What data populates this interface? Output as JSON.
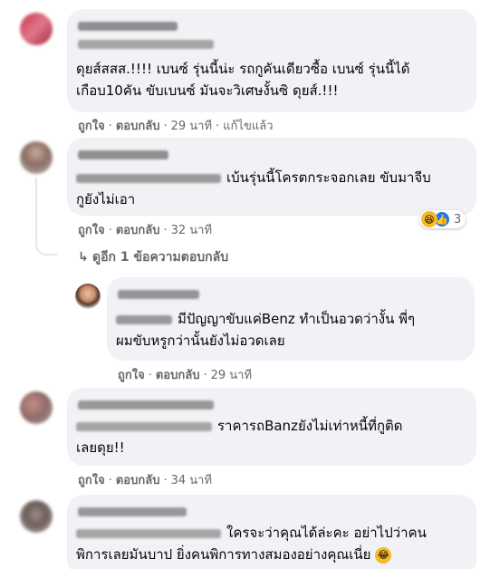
{
  "colors": {
    "bubble": "#f0f2f5",
    "secondary_text": "#65676b",
    "like_blue": "#1877f2",
    "haha_yellow": "#f7b928"
  },
  "comments": [
    {
      "text_lines": [
        "ดุยส์สสส.!!!! เบนซ์ รุ่นนี้น่ะ รถกูคันเดียวซื้อ เบนซ์ รุ่นนี้ได้",
        "เกือบ10คัน ขับเบนซ์ มันจะวิเศษงั้นซิ ดุยส์.!!!"
      ],
      "like_label": "ถูกใจ",
      "reply_label": "ตอบกลับ",
      "time": "29 นาที",
      "edited": "แก้ไขแล้ว"
    },
    {
      "text_lines": [
        "เบ้นรุ่นนี้โครตกระจอกเลย ขับมาจีบ",
        "กูยังไม่เอา"
      ],
      "like_label": "ถูกใจ",
      "reply_label": "ตอบกลับ",
      "time": "32 นาที",
      "reaction_count": "3",
      "reaction_icons": [
        "haha-icon",
        "like-icon"
      ],
      "view_more": "ดูอีก 1 ข้อความตอบกลับ"
    },
    {
      "text_lines": [
        "มีปัญญาขับแค่Benz ทำเป็นอวดว่างั้น พี่ๆ",
        "ผมขับหรูกว่านั้นยังไม่อวดเลย"
      ],
      "like_label": "ถูกใจ",
      "reply_label": "ตอบกลับ",
      "time": "29 นาที"
    },
    {
      "text_lines": [
        "ราคารถBanzยังไม่เท่าหนี้ที่กูติด",
        "เลยดุย!!"
      ],
      "like_label": "ถูกใจ",
      "reply_label": "ตอบกลับ",
      "time": "34 นาที"
    },
    {
      "text_lines": [
        "ใครจะว่าคุณได้ล่ะคะ อย่าไปว่าคน",
        "พิการเลยมันบาป ยิ่งคนพิการทางสมองอย่างคุณเนี่ย"
      ],
      "emoji": "😂"
    }
  ]
}
